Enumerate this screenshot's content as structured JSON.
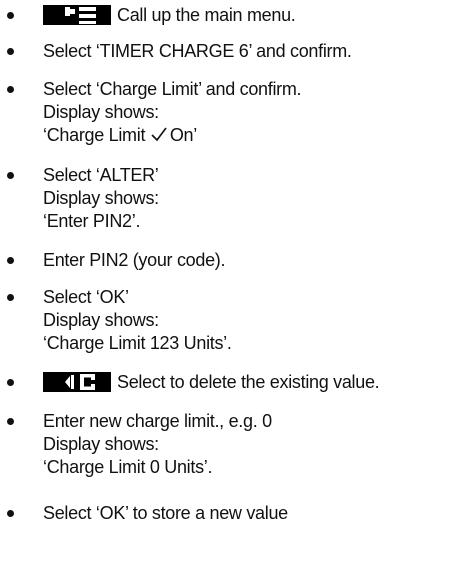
{
  "steps": [
    {
      "key_icon": "main-menu-icon",
      "lines": [
        "Call up the main menu."
      ]
    },
    {
      "lines": [
        "Select ‘TIMER CHARGE 6’ and confirm."
      ]
    },
    {
      "lines": [
        "Select ‘Charge Limit’ and confirm.",
        "Display shows:"
      ],
      "display_prefix": "‘Charge Limit ",
      "display_suffix": "On’"
    },
    {
      "lines": [
        "Select ‘ALTER’",
        "Display shows:",
        "‘Enter PIN2’."
      ]
    },
    {
      "lines": [
        "Enter PIN2 (your code)."
      ]
    },
    {
      "lines": [
        "Select ‘OK’",
        "Display shows:",
        "‘Charge Limit 123 Units’."
      ]
    },
    {
      "key_icon": "delete-key-icon",
      "lines": [
        "Select to delete the existing value."
      ]
    },
    {
      "lines": [
        "Enter new charge limit., e.g. 0",
        "Display shows:",
        "‘Charge Limit 0 Units’."
      ]
    },
    {
      "lines": [
        "Select ‘OK’ to store a new value"
      ]
    }
  ]
}
